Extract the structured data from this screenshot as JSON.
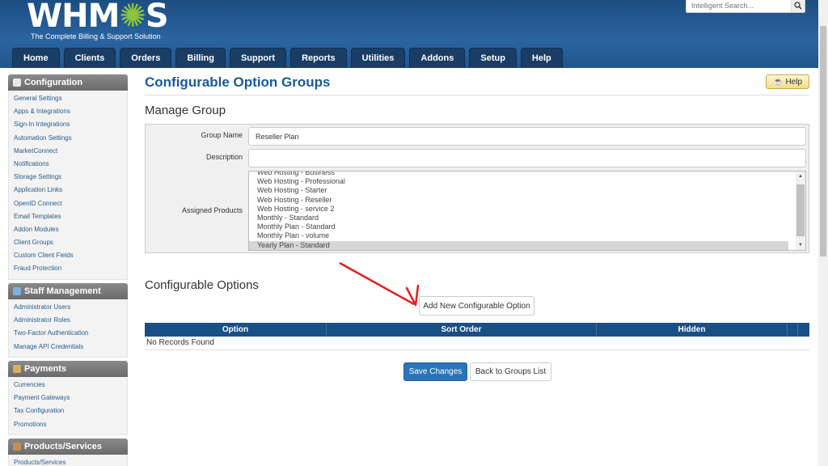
{
  "header": {
    "logo_text": "WHMCS",
    "logo_tagline": "The Complete Billing & Support Solution",
    "search_placeholder": "Intelligent Search...",
    "nav": [
      "Home",
      "Clients",
      "Orders",
      "Billing",
      "Support",
      "Reports",
      "Utilities",
      "Addons",
      "Setup",
      "Help"
    ]
  },
  "sidebar": {
    "sections": [
      {
        "title": "Configuration",
        "items": [
          "General Settings",
          "Apps & Integrations",
          "Sign-In Integrations",
          "Automation Settings",
          "MarketConnect",
          "Notifications",
          "Storage Settings",
          "Application Links",
          "OpenID Connect",
          "Email Templates",
          "Addon Modules",
          "Client Groups",
          "Custom Client Fields",
          "Fraud Protection"
        ]
      },
      {
        "title": "Staff Management",
        "items": [
          "Administrator Users",
          "Administrator Roles",
          "Two-Factor Authentication",
          "Manage API Credentials"
        ]
      },
      {
        "title": "Payments",
        "items": [
          "Currencies",
          "Payment Gateways",
          "Tax Configuration",
          "Promotions"
        ]
      },
      {
        "title": "Products/Services",
        "items": [
          "Products/Services"
        ]
      }
    ]
  },
  "main": {
    "page_title": "Configurable Option Groups",
    "help_label": "Help",
    "manage_group_title": "Manage Group",
    "group_name_label": "Group Name",
    "group_name_value": "Reseller Plan",
    "description_label": "Description",
    "description_value": "",
    "assigned_products_label": "Assigned Products",
    "assigned_products": [
      {
        "label": "Web Hosting - Business",
        "selected": false
      },
      {
        "label": "Web Hosting - Professional",
        "selected": false
      },
      {
        "label": "Web Hosting - Starter",
        "selected": false
      },
      {
        "label": "Web Hosting - Reseller",
        "selected": false
      },
      {
        "label": "Web Hosting - service 2",
        "selected": false
      },
      {
        "label": "Monthly - Standard",
        "selected": false
      },
      {
        "label": "Monthly Plan - Standard",
        "selected": false
      },
      {
        "label": "Monthly Plan - volume",
        "selected": false
      },
      {
        "label": "Yearly Plan - Standard",
        "selected": true
      }
    ],
    "configurable_options_title": "Configurable Options",
    "add_option_label": "Add New Configurable Option",
    "table_headers": [
      "Option",
      "Sort Order",
      "Hidden"
    ],
    "no_records": "No Records Found",
    "save_label": "Save Changes",
    "back_label": "Back to Groups List"
  },
  "colors": {
    "header_blue": "#2a64a0",
    "nav_tab": "#1a3d66",
    "title_blue": "#1a5a96",
    "primary_button": "#2a74b8",
    "annotation_arrow": "#e02020"
  }
}
